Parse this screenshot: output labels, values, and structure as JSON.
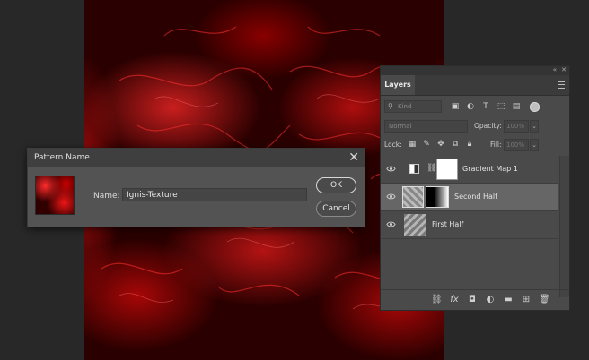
{
  "dialog": {
    "title": "Pattern Name",
    "name_label": "Name:",
    "name_value": "Ignis-Texture",
    "ok_label": "OK",
    "cancel_label": "Cancel",
    "close_glyph": "✕"
  },
  "layers_panel": {
    "tab_label": "Layers",
    "filter_placeholder": "Kind",
    "blend_mode": "Normal",
    "opacity_label": "Opacity:",
    "opacity_value": "100%",
    "lock_label": "Lock:",
    "fill_label": "Fill:",
    "fill_value": "100%",
    "layers": [
      {
        "name": "Gradient Map 1",
        "selected": false,
        "icon": "gradient-map-adjustment-icon"
      },
      {
        "name": "Second Half",
        "selected": true,
        "icon": "layer-mask-icon"
      },
      {
        "name": "First Half",
        "selected": false,
        "icon": "smart-object-icon"
      }
    ],
    "footer_icons": [
      "link-layers-icon",
      "fx-icon",
      "add-mask-icon",
      "adjustment-layer-icon",
      "new-group-icon",
      "new-layer-icon",
      "trash-icon"
    ]
  },
  "colors": {
    "canvas_red": "#e00000",
    "panel_bg": "#4a4a4a",
    "selected_row": "#666666",
    "dialog_bg": "#535353"
  }
}
